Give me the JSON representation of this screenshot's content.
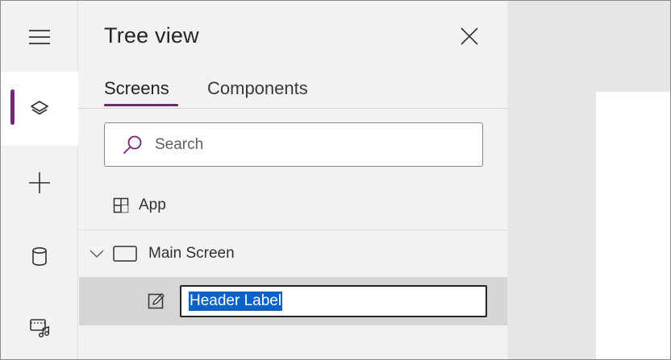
{
  "rail": {
    "items": [
      {
        "icon": "hamburger-menu-icon",
        "active": false
      },
      {
        "icon": "layers-icon",
        "active": true
      },
      {
        "icon": "plus-icon",
        "active": false
      },
      {
        "icon": "database-icon",
        "active": false
      },
      {
        "icon": "media-icon",
        "active": false
      }
    ],
    "accent": "#742774"
  },
  "panel": {
    "title": "Tree view",
    "tabs": [
      {
        "label": "Screens",
        "selected": true
      },
      {
        "label": "Components",
        "selected": false
      }
    ],
    "search": {
      "placeholder": "Search"
    },
    "tree": {
      "app_label": "App",
      "screen_label": "Main Screen",
      "control_label": "Header Label"
    }
  },
  "colors": {
    "accent": "#742774",
    "selection": "#0a62c9",
    "panel_bg": "#f3f2f1",
    "selected_row_bg": "#d5d5d5"
  }
}
